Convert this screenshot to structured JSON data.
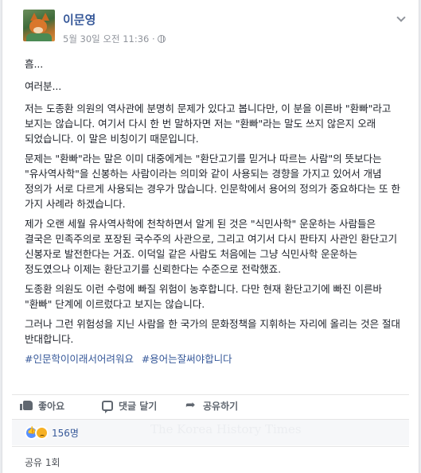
{
  "post": {
    "author": "이문영",
    "timestamp": "5월 30일 오전 11:36 ·",
    "privacy_icon": "globe-icon",
    "paragraphs": [
      "흠...",
      "여러분...",
      "저는 도종환 의원의 역사관에 분명히 문제가 있다고 봅니다만, 이 분을 이른바 \"환빠\"라고 보지는 않습니다. 여기서 다시 한 번 말하자면 저는 \"환빠\"라는 말도 쓰지 않은지 오래 되었습니다. 이 말은 비칭이기 때문입니다.",
      "문제는 \"환빠\"라는 말은 이미 대중에게는 \"환단고기를 믿거나 따르는 사람\"의 뜻보다는 \"유사역사학\"을 신봉하는 사람이라는 의미와 같이 사용되는 경향을 가지고 있어서 개념 정의가 서로 다르게 사용되는 경우가 많습니다. 인문학에서 용어의 정의가 중요하다는 또 한 가지 사례라 하겠습니다.",
      "제가 오랜 세월 유사역사학에 천착하면서 알게 된 것은 \"식민사학\" 운운하는 사람들은 결국은 민족주의로 포장된 국수주의 사관으로, 그리고 여기서 다시 판타지 사관인 환단고기 신봉자로 발전한다는 거죠. 이덕일 같은 사람도 처음에는 그냥 식민사학 운운하는 정도였으나 이제는 환단고기를 신뢰한다는 수준으로 전락했죠.",
      "도종환 의원도 이런 수렁에 빠질 위험이 농후합니다. 다만 현재 환단고기에 빠진 이른바 \"환빠\" 단계에 이르렀다고 보지는 않습니다.",
      "그러나 그런 위험성을 지닌 사람을 한 국가의 문화정책을 지휘하는 자리에 올리는 것은 절대 반대합니다."
    ],
    "hashtags": [
      "#인문학이이래서어려워요",
      "#용어는잘써야합니다"
    ]
  },
  "actions": {
    "like_label": "좋아요",
    "comment_label": "댓글 달기",
    "share_label": "공유하기"
  },
  "reactions": {
    "count": "156명",
    "types": [
      "like",
      "sad"
    ]
  },
  "shares": {
    "label": "공유 1회"
  },
  "watermark": "The Korea History Times",
  "colors": {
    "link": "#365899",
    "meta": "#90949c",
    "action": "#606770",
    "background": "#e9ebee"
  }
}
